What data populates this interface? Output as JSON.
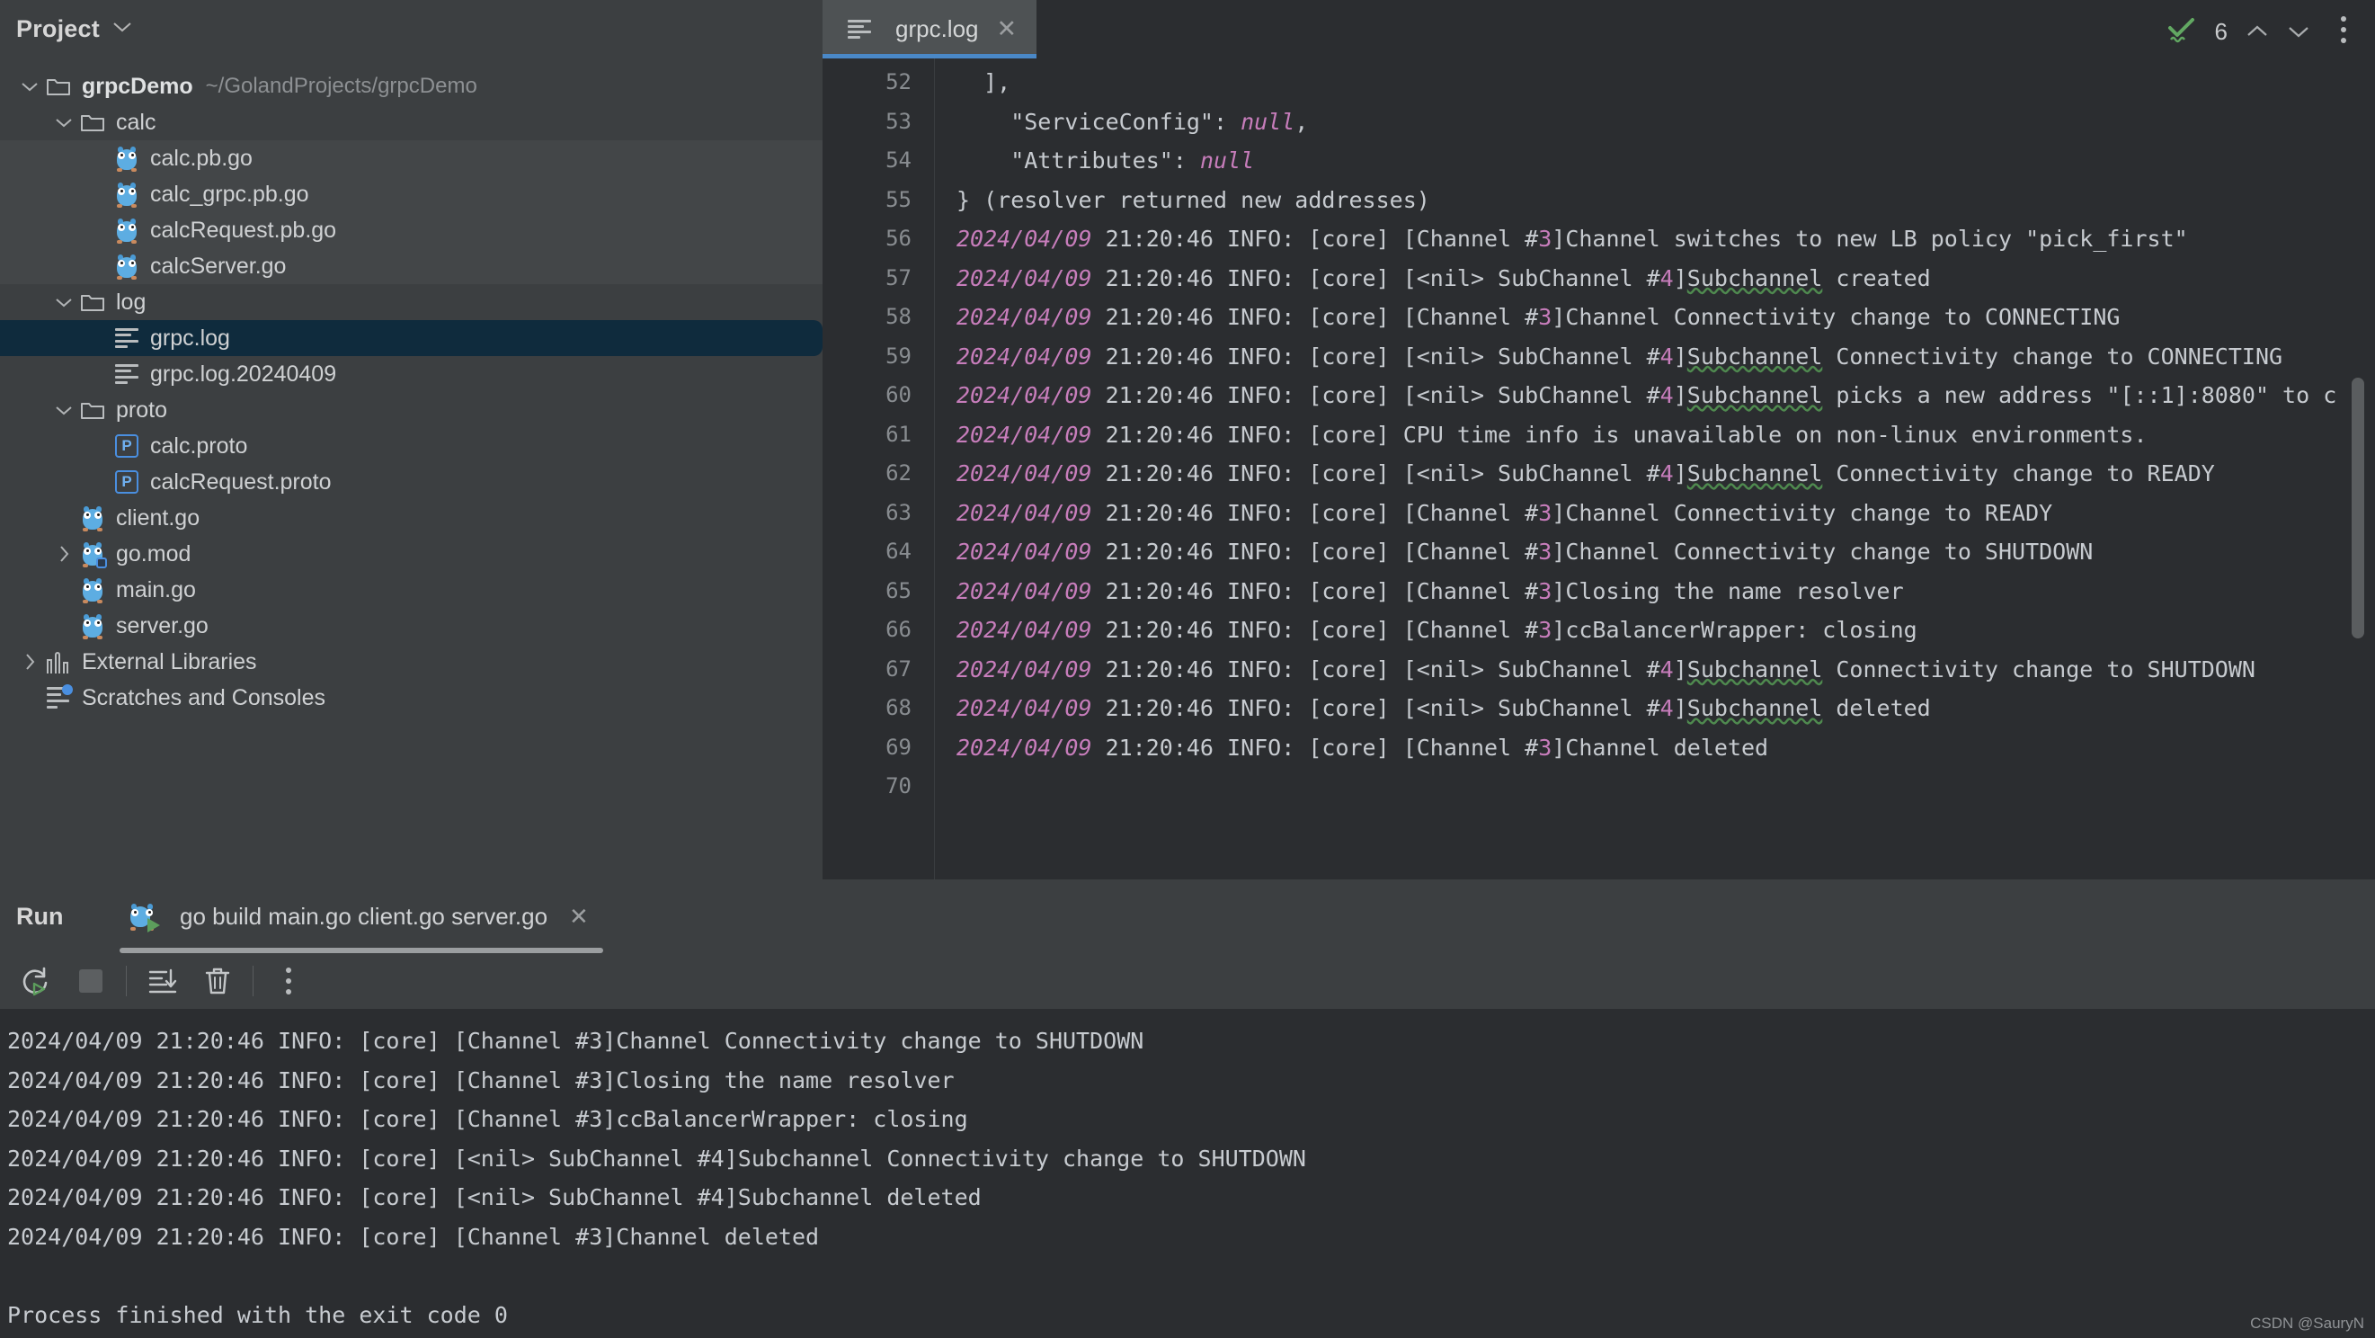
{
  "sidebar": {
    "title": "Project",
    "chevron_icon": "chevron-down-icon",
    "tree": [
      {
        "indent": 0,
        "twisty": "expanded",
        "icon": "folder-icon",
        "label": "grpcDemo",
        "bold": true,
        "path": "~/GolandProjects/grpcDemo",
        "state": "normal"
      },
      {
        "indent": 1,
        "twisty": "expanded",
        "icon": "folder-icon",
        "label": "calc",
        "state": "normal"
      },
      {
        "indent": 2,
        "twisty": "none",
        "icon": "go-file-icon",
        "label": "calc.pb.go",
        "state": "hover"
      },
      {
        "indent": 2,
        "twisty": "none",
        "icon": "go-file-icon",
        "label": "calc_grpc.pb.go",
        "state": "hover"
      },
      {
        "indent": 2,
        "twisty": "none",
        "icon": "go-file-icon",
        "label": "calcRequest.pb.go",
        "state": "hover"
      },
      {
        "indent": 2,
        "twisty": "none",
        "icon": "go-file-icon",
        "label": "calcServer.go",
        "state": "hover"
      },
      {
        "indent": 1,
        "twisty": "expanded",
        "icon": "folder-icon",
        "label": "log",
        "state": "normal"
      },
      {
        "indent": 2,
        "twisty": "none",
        "icon": "log-file-icon",
        "label": "grpc.log",
        "state": "selected"
      },
      {
        "indent": 2,
        "twisty": "none",
        "icon": "log-file-icon",
        "label": "grpc.log.20240409",
        "state": "normal"
      },
      {
        "indent": 1,
        "twisty": "expanded",
        "icon": "folder-icon",
        "label": "proto",
        "state": "normal"
      },
      {
        "indent": 2,
        "twisty": "none",
        "icon": "proto-file-icon",
        "label": "calc.proto",
        "state": "normal"
      },
      {
        "indent": 2,
        "twisty": "none",
        "icon": "proto-file-icon",
        "label": "calcRequest.proto",
        "state": "normal"
      },
      {
        "indent": 1,
        "twisty": "none",
        "icon": "go-file-icon",
        "label": "client.go",
        "state": "normal"
      },
      {
        "indent": 1,
        "twisty": "collapsed",
        "icon": "go-mod-icon",
        "label": "go.mod",
        "state": "normal"
      },
      {
        "indent": 1,
        "twisty": "none",
        "icon": "go-file-icon",
        "label": "main.go",
        "state": "normal"
      },
      {
        "indent": 1,
        "twisty": "none",
        "icon": "go-file-icon",
        "label": "server.go",
        "state": "normal"
      },
      {
        "indent": 0,
        "twisty": "collapsed",
        "icon": "library-icon",
        "label": "External Libraries",
        "state": "normal"
      },
      {
        "indent": 0,
        "twisty": "none",
        "icon": "scratches-icon",
        "label": "Scratches and Consoles",
        "state": "normal"
      }
    ]
  },
  "editor": {
    "tab": {
      "label": "grpc.log",
      "icon": "log-file-icon",
      "close_icon": "close-icon",
      "active": true
    },
    "kebab_icon": "more-vertical-icon",
    "inspections": {
      "status_icon": "inspection-ok-icon",
      "count": "6",
      "prev_icon": "chevron-up-icon",
      "next_icon": "chevron-down-icon"
    },
    "first_line_number": 52,
    "lines": [
      {
        "n": 52,
        "parts": [
          {
            "t": "  ],"
          }
        ]
      },
      {
        "n": 53,
        "parts": [
          {
            "t": "    \"ServiceConfig\": "
          },
          {
            "t": "null",
            "c": "null"
          },
          {
            "t": ","
          }
        ]
      },
      {
        "n": 54,
        "parts": [
          {
            "t": "    \"Attributes\": "
          },
          {
            "t": "null",
            "c": "null"
          }
        ]
      },
      {
        "n": 55,
        "parts": [
          {
            "t": "} (resolver returned new addresses)"
          }
        ]
      },
      {
        "n": 56,
        "parts": [
          {
            "t": "2024/04/09",
            "c": "date"
          },
          {
            "t": " 21:20:46 INFO: [core] [Channel #"
          },
          {
            "t": "3",
            "c": "num"
          },
          {
            "t": "]Channel switches to new LB policy \"pick_first\""
          }
        ]
      },
      {
        "n": 57,
        "parts": [
          {
            "t": "2024/04/09",
            "c": "date"
          },
          {
            "t": " 21:20:46 INFO: [core] [<nil> SubChannel #"
          },
          {
            "t": "4",
            "c": "num"
          },
          {
            "t": "]"
          },
          {
            "t": "Subchannel",
            "c": "typo"
          },
          {
            "t": " created"
          }
        ]
      },
      {
        "n": 58,
        "parts": [
          {
            "t": "2024/04/09",
            "c": "date"
          },
          {
            "t": " 21:20:46 INFO: [core] [Channel #"
          },
          {
            "t": "3",
            "c": "num"
          },
          {
            "t": "]Channel Connectivity change to CONNECTING"
          }
        ]
      },
      {
        "n": 59,
        "parts": [
          {
            "t": "2024/04/09",
            "c": "date"
          },
          {
            "t": " 21:20:46 INFO: [core] [<nil> SubChannel #"
          },
          {
            "t": "4",
            "c": "num"
          },
          {
            "t": "]"
          },
          {
            "t": "Subchannel",
            "c": "typo"
          },
          {
            "t": " Connectivity change to CONNECTING"
          }
        ]
      },
      {
        "n": 60,
        "parts": [
          {
            "t": "2024/04/09",
            "c": "date"
          },
          {
            "t": " 21:20:46 INFO: [core] [<nil> SubChannel #"
          },
          {
            "t": "4",
            "c": "num"
          },
          {
            "t": "]"
          },
          {
            "t": "Subchannel",
            "c": "typo"
          },
          {
            "t": " picks a new address \"[::1]:8080\" to c"
          }
        ]
      },
      {
        "n": 61,
        "parts": [
          {
            "t": "2024/04/09",
            "c": "date"
          },
          {
            "t": " 21:20:46 INFO: [core] CPU time info is unavailable on non-linux environments."
          }
        ]
      },
      {
        "n": 62,
        "parts": [
          {
            "t": "2024/04/09",
            "c": "date"
          },
          {
            "t": " 21:20:46 INFO: [core] [<nil> SubChannel #"
          },
          {
            "t": "4",
            "c": "num"
          },
          {
            "t": "]"
          },
          {
            "t": "Subchannel",
            "c": "typo"
          },
          {
            "t": " Connectivity change to READY"
          }
        ]
      },
      {
        "n": 63,
        "parts": [
          {
            "t": "2024/04/09",
            "c": "date"
          },
          {
            "t": " 21:20:46 INFO: [core] [Channel #"
          },
          {
            "t": "3",
            "c": "num"
          },
          {
            "t": "]Channel Connectivity change to READY"
          }
        ]
      },
      {
        "n": 64,
        "parts": [
          {
            "t": "2024/04/09",
            "c": "date"
          },
          {
            "t": " 21:20:46 INFO: [core] [Channel #"
          },
          {
            "t": "3",
            "c": "num"
          },
          {
            "t": "]Channel Connectivity change to SHUTDOWN"
          }
        ]
      },
      {
        "n": 65,
        "parts": [
          {
            "t": "2024/04/09",
            "c": "date"
          },
          {
            "t": " 21:20:46 INFO: [core] [Channel #"
          },
          {
            "t": "3",
            "c": "num"
          },
          {
            "t": "]Closing the name resolver"
          }
        ]
      },
      {
        "n": 66,
        "parts": [
          {
            "t": "2024/04/09",
            "c": "date"
          },
          {
            "t": " 21:20:46 INFO: [core] [Channel #"
          },
          {
            "t": "3",
            "c": "num"
          },
          {
            "t": "]ccBalancerWrapper: closing"
          }
        ]
      },
      {
        "n": 67,
        "parts": [
          {
            "t": "2024/04/09",
            "c": "date"
          },
          {
            "t": " 21:20:46 INFO: [core] [<nil> SubChannel #"
          },
          {
            "t": "4",
            "c": "num"
          },
          {
            "t": "]"
          },
          {
            "t": "Subchannel",
            "c": "typo"
          },
          {
            "t": " Connectivity change to SHUTDOWN"
          }
        ]
      },
      {
        "n": 68,
        "parts": [
          {
            "t": "2024/04/09",
            "c": "date"
          },
          {
            "t": " 21:20:46 INFO: [core] [<nil> SubChannel #"
          },
          {
            "t": "4",
            "c": "num"
          },
          {
            "t": "]"
          },
          {
            "t": "Subchannel",
            "c": "typo"
          },
          {
            "t": " deleted"
          }
        ]
      },
      {
        "n": 69,
        "parts": [
          {
            "t": "2024/04/09",
            "c": "date"
          },
          {
            "t": " 21:20:46 INFO: [core] [Channel #"
          },
          {
            "t": "3",
            "c": "num"
          },
          {
            "t": "]Channel deleted"
          }
        ]
      },
      {
        "n": 70,
        "parts": [
          {
            "t": ""
          }
        ]
      }
    ]
  },
  "run_panel": {
    "title": "Run",
    "tab": {
      "label": "go build main.go client.go server.go",
      "icon": "go-run-icon",
      "close_icon": "close-icon"
    },
    "toolbar": [
      {
        "name": "rerun-button",
        "icon": "rerun-icon",
        "enabled": true
      },
      {
        "name": "stop-button",
        "icon": "stop-icon",
        "enabled": false
      },
      {
        "name": "scroll-to-end-button",
        "icon": "scroll-to-end-icon",
        "enabled": true
      },
      {
        "name": "clear-all-button",
        "icon": "trash-icon",
        "enabled": true
      },
      {
        "name": "more-options-button",
        "icon": "more-vertical-icon",
        "enabled": true
      }
    ],
    "console_lines": [
      "2024/04/09 21:20:46 INFO: [core] [Channel #3]Channel Connectivity change to SHUTDOWN",
      "2024/04/09 21:20:46 INFO: [core] [Channel #3]Closing the name resolver",
      "2024/04/09 21:20:46 INFO: [core] [Channel #3]ccBalancerWrapper: closing",
      "2024/04/09 21:20:46 INFO: [core] [<nil> SubChannel #4]Subchannel Connectivity change to SHUTDOWN",
      "2024/04/09 21:20:46 INFO: [core] [<nil> SubChannel #4]Subchannel deleted",
      "2024/04/09 21:20:46 INFO: [core] [Channel #3]Channel deleted",
      "",
      "Process finished with the exit code 0"
    ]
  },
  "watermark": "CSDN @SauryN",
  "colors": {
    "sidebar_bg": "#3c3f41",
    "editor_bg": "#2b2d30",
    "tab_active_bg": "#4e5254",
    "tab_accent": "#4a88c7",
    "selection_bg": "#0f2b3d",
    "text": "#c7cbd0",
    "purple": "#c77dbb",
    "typo_underline": "#4f8a4f",
    "gopher_blue": "#5dade2"
  }
}
